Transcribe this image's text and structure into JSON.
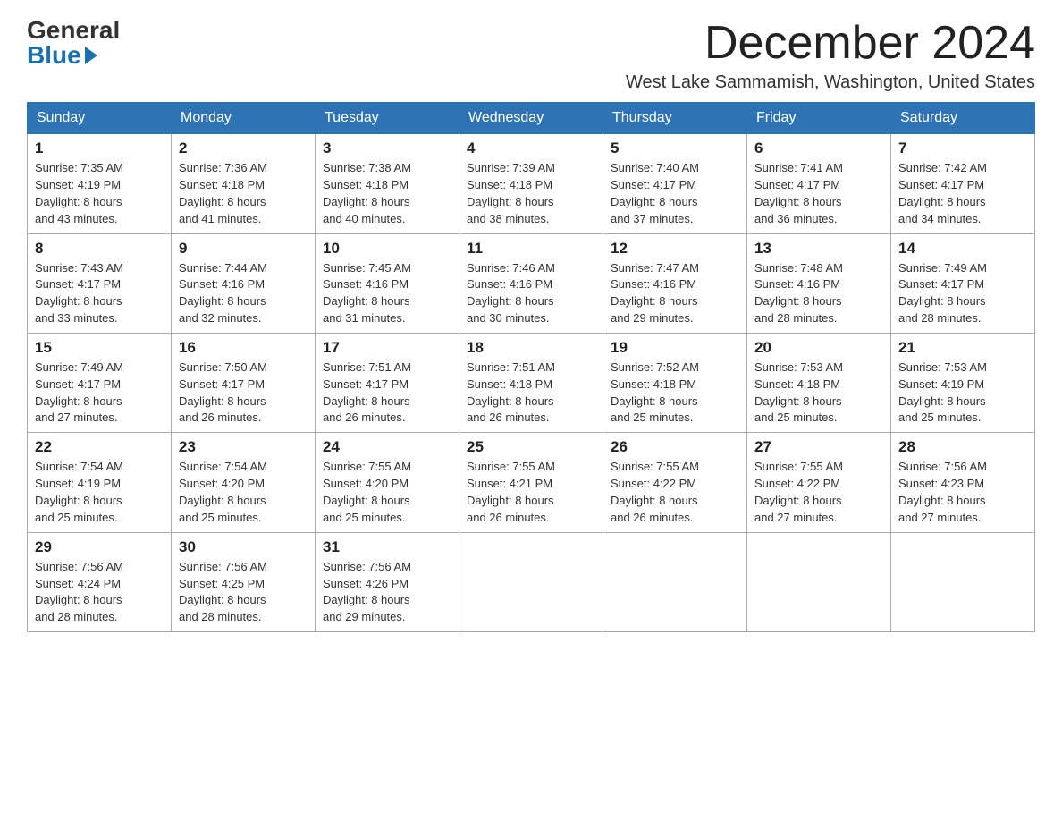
{
  "header": {
    "logo_general": "General",
    "logo_blue": "Blue",
    "month_title": "December 2024",
    "location": "West Lake Sammamish, Washington, United States"
  },
  "days_of_week": [
    "Sunday",
    "Monday",
    "Tuesday",
    "Wednesday",
    "Thursday",
    "Friday",
    "Saturday"
  ],
  "weeks": [
    [
      {
        "day": "1",
        "sunrise": "7:35 AM",
        "sunset": "4:19 PM",
        "daylight": "8 hours and 43 minutes."
      },
      {
        "day": "2",
        "sunrise": "7:36 AM",
        "sunset": "4:18 PM",
        "daylight": "8 hours and 41 minutes."
      },
      {
        "day": "3",
        "sunrise": "7:38 AM",
        "sunset": "4:18 PM",
        "daylight": "8 hours and 40 minutes."
      },
      {
        "day": "4",
        "sunrise": "7:39 AM",
        "sunset": "4:18 PM",
        "daylight": "8 hours and 38 minutes."
      },
      {
        "day": "5",
        "sunrise": "7:40 AM",
        "sunset": "4:17 PM",
        "daylight": "8 hours and 37 minutes."
      },
      {
        "day": "6",
        "sunrise": "7:41 AM",
        "sunset": "4:17 PM",
        "daylight": "8 hours and 36 minutes."
      },
      {
        "day": "7",
        "sunrise": "7:42 AM",
        "sunset": "4:17 PM",
        "daylight": "8 hours and 34 minutes."
      }
    ],
    [
      {
        "day": "8",
        "sunrise": "7:43 AM",
        "sunset": "4:17 PM",
        "daylight": "8 hours and 33 minutes."
      },
      {
        "day": "9",
        "sunrise": "7:44 AM",
        "sunset": "4:16 PM",
        "daylight": "8 hours and 32 minutes."
      },
      {
        "day": "10",
        "sunrise": "7:45 AM",
        "sunset": "4:16 PM",
        "daylight": "8 hours and 31 minutes."
      },
      {
        "day": "11",
        "sunrise": "7:46 AM",
        "sunset": "4:16 PM",
        "daylight": "8 hours and 30 minutes."
      },
      {
        "day": "12",
        "sunrise": "7:47 AM",
        "sunset": "4:16 PM",
        "daylight": "8 hours and 29 minutes."
      },
      {
        "day": "13",
        "sunrise": "7:48 AM",
        "sunset": "4:16 PM",
        "daylight": "8 hours and 28 minutes."
      },
      {
        "day": "14",
        "sunrise": "7:49 AM",
        "sunset": "4:17 PM",
        "daylight": "8 hours and 28 minutes."
      }
    ],
    [
      {
        "day": "15",
        "sunrise": "7:49 AM",
        "sunset": "4:17 PM",
        "daylight": "8 hours and 27 minutes."
      },
      {
        "day": "16",
        "sunrise": "7:50 AM",
        "sunset": "4:17 PM",
        "daylight": "8 hours and 26 minutes."
      },
      {
        "day": "17",
        "sunrise": "7:51 AM",
        "sunset": "4:17 PM",
        "daylight": "8 hours and 26 minutes."
      },
      {
        "day": "18",
        "sunrise": "7:51 AM",
        "sunset": "4:18 PM",
        "daylight": "8 hours and 26 minutes."
      },
      {
        "day": "19",
        "sunrise": "7:52 AM",
        "sunset": "4:18 PM",
        "daylight": "8 hours and 25 minutes."
      },
      {
        "day": "20",
        "sunrise": "7:53 AM",
        "sunset": "4:18 PM",
        "daylight": "8 hours and 25 minutes."
      },
      {
        "day": "21",
        "sunrise": "7:53 AM",
        "sunset": "4:19 PM",
        "daylight": "8 hours and 25 minutes."
      }
    ],
    [
      {
        "day": "22",
        "sunrise": "7:54 AM",
        "sunset": "4:19 PM",
        "daylight": "8 hours and 25 minutes."
      },
      {
        "day": "23",
        "sunrise": "7:54 AM",
        "sunset": "4:20 PM",
        "daylight": "8 hours and 25 minutes."
      },
      {
        "day": "24",
        "sunrise": "7:55 AM",
        "sunset": "4:20 PM",
        "daylight": "8 hours and 25 minutes."
      },
      {
        "day": "25",
        "sunrise": "7:55 AM",
        "sunset": "4:21 PM",
        "daylight": "8 hours and 26 minutes."
      },
      {
        "day": "26",
        "sunrise": "7:55 AM",
        "sunset": "4:22 PM",
        "daylight": "8 hours and 26 minutes."
      },
      {
        "day": "27",
        "sunrise": "7:55 AM",
        "sunset": "4:22 PM",
        "daylight": "8 hours and 27 minutes."
      },
      {
        "day": "28",
        "sunrise": "7:56 AM",
        "sunset": "4:23 PM",
        "daylight": "8 hours and 27 minutes."
      }
    ],
    [
      {
        "day": "29",
        "sunrise": "7:56 AM",
        "sunset": "4:24 PM",
        "daylight": "8 hours and 28 minutes."
      },
      {
        "day": "30",
        "sunrise": "7:56 AM",
        "sunset": "4:25 PM",
        "daylight": "8 hours and 28 minutes."
      },
      {
        "day": "31",
        "sunrise": "7:56 AM",
        "sunset": "4:26 PM",
        "daylight": "8 hours and 29 minutes."
      },
      null,
      null,
      null,
      null
    ]
  ],
  "labels": {
    "sunrise": "Sunrise: ",
    "sunset": "Sunset: ",
    "daylight": "Daylight: "
  }
}
